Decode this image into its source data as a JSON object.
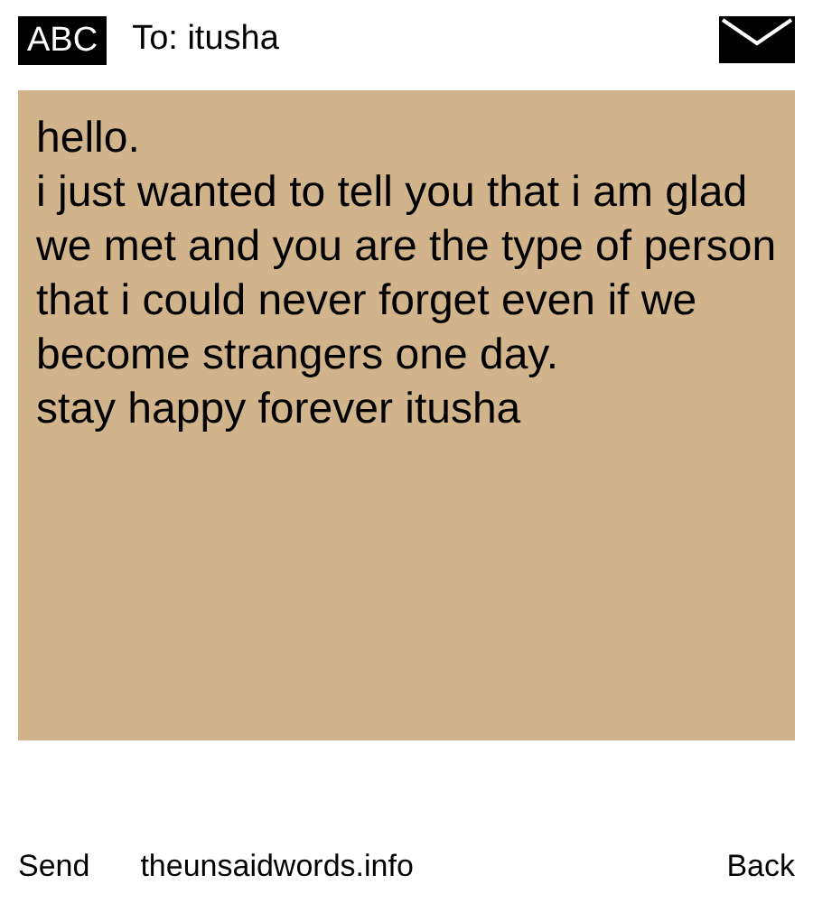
{
  "header": {
    "badge": "ABC",
    "recipient": "To: itusha"
  },
  "message": {
    "paragraphs": [
      "hello.",
      "i just wanted to tell you that i am glad we met and you are the type of person that i could never forget even if we become strangers one day.",
      "stay happy forever itusha"
    ]
  },
  "softkeys": {
    "left": "Send",
    "center": "theunsaidwords.info",
    "right": "Back"
  }
}
